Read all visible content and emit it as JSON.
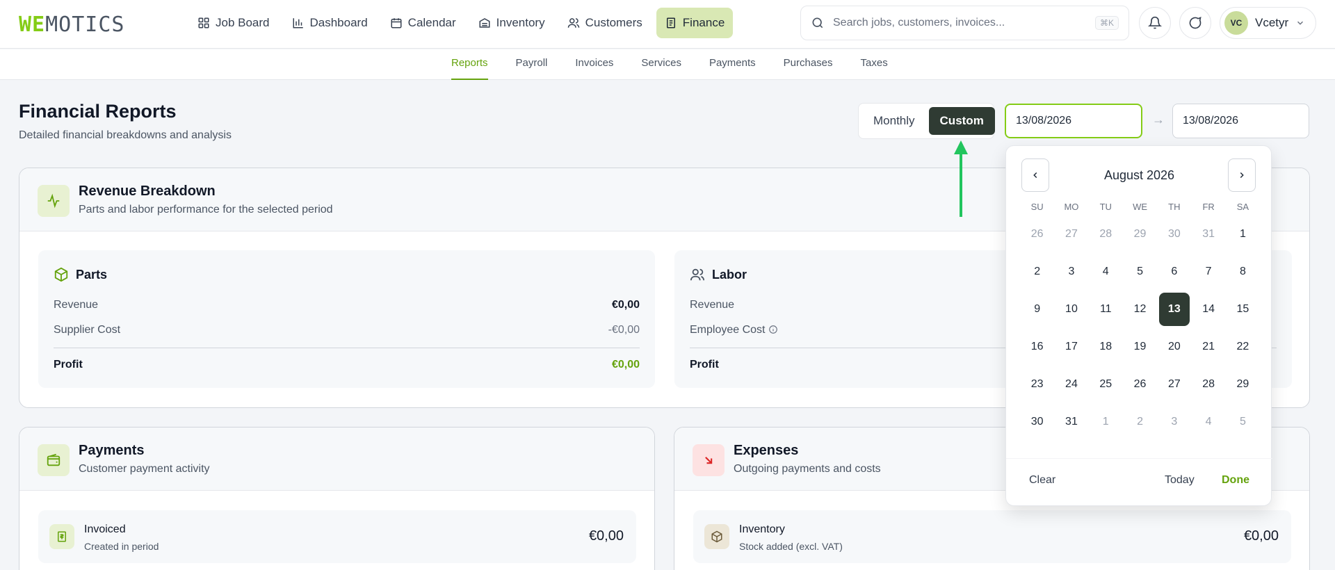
{
  "brand": {
    "logo_we": "WE",
    "logo_rest": "MOTICS"
  },
  "nav": {
    "items": [
      {
        "label": "Job Board",
        "icon": "grid-icon"
      },
      {
        "label": "Dashboard",
        "icon": "bar-chart-icon"
      },
      {
        "label": "Calendar",
        "icon": "calendar-icon"
      },
      {
        "label": "Inventory",
        "icon": "warehouse-icon"
      },
      {
        "label": "Customers",
        "icon": "users-icon"
      },
      {
        "label": "Finance",
        "icon": "receipt-icon",
        "active": true
      }
    ]
  },
  "search": {
    "placeholder": "Search jobs, customers, invoices...",
    "shortcut": "⌘K"
  },
  "user": {
    "initials": "VC",
    "name": "Vcetyr"
  },
  "subnav": {
    "items": [
      "Reports",
      "Payroll",
      "Invoices",
      "Services",
      "Payments",
      "Purchases",
      "Taxes"
    ],
    "active": "Reports"
  },
  "header": {
    "title": "Financial Reports",
    "subtitle": "Detailed financial breakdowns and analysis"
  },
  "period": {
    "monthly": "Monthly",
    "custom": "Custom",
    "start": "13/08/2026",
    "end": "13/08/2026",
    "arrow": "→"
  },
  "revenue": {
    "title": "Revenue Breakdown",
    "subtitle": "Parts and labor performance for the selected period",
    "parts": {
      "title": "Parts",
      "revenue_label": "Revenue",
      "revenue": "€0,00",
      "cost_label": "Supplier Cost",
      "cost": "-€0,00",
      "profit_label": "Profit",
      "profit": "€0,00"
    },
    "labor": {
      "title": "Labor",
      "revenue_label": "Revenue",
      "cost_label": "Employee Cost",
      "profit_label": "Profit"
    }
  },
  "payments": {
    "title": "Payments",
    "subtitle": "Customer payment activity",
    "invoiced": {
      "name": "Invoiced",
      "sub": "Created in period",
      "value": "€0,00"
    }
  },
  "expenses": {
    "title": "Expenses",
    "subtitle": "Outgoing payments and costs",
    "inventory": {
      "name": "Inventory",
      "sub": "Stock added (excl. VAT)",
      "value": "€0,00"
    }
  },
  "calendar": {
    "month": "August 2026",
    "dow": [
      "SU",
      "MO",
      "TU",
      "WE",
      "TH",
      "FR",
      "SA"
    ],
    "days": [
      {
        "d": "26",
        "m": true
      },
      {
        "d": "27",
        "m": true
      },
      {
        "d": "28",
        "m": true
      },
      {
        "d": "29",
        "m": true
      },
      {
        "d": "30",
        "m": true
      },
      {
        "d": "31",
        "m": true
      },
      {
        "d": "1"
      },
      {
        "d": "2"
      },
      {
        "d": "3"
      },
      {
        "d": "4"
      },
      {
        "d": "5"
      },
      {
        "d": "6"
      },
      {
        "d": "7"
      },
      {
        "d": "8"
      },
      {
        "d": "9"
      },
      {
        "d": "10"
      },
      {
        "d": "11"
      },
      {
        "d": "12"
      },
      {
        "d": "13",
        "sel": true
      },
      {
        "d": "14"
      },
      {
        "d": "15"
      },
      {
        "d": "16"
      },
      {
        "d": "17"
      },
      {
        "d": "18"
      },
      {
        "d": "19"
      },
      {
        "d": "20"
      },
      {
        "d": "21"
      },
      {
        "d": "22"
      },
      {
        "d": "23"
      },
      {
        "d": "24"
      },
      {
        "d": "25"
      },
      {
        "d": "26"
      },
      {
        "d": "27"
      },
      {
        "d": "28"
      },
      {
        "d": "29"
      },
      {
        "d": "30"
      },
      {
        "d": "31"
      },
      {
        "d": "1",
        "m": true
      },
      {
        "d": "2",
        "m": true
      },
      {
        "d": "3",
        "m": true
      },
      {
        "d": "4",
        "m": true
      },
      {
        "d": "5",
        "m": true
      }
    ],
    "clear": "Clear",
    "today": "Today",
    "done": "Done"
  },
  "colors": {
    "accent": "#84cc16",
    "accent_dark": "#65a30d",
    "selected": "#2f3b33",
    "annotation_arrow": "#22c55e"
  }
}
